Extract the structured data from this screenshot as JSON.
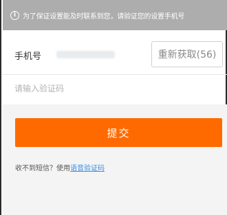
{
  "notice": {
    "icon": "info-circle-icon",
    "icon_glyph": "i",
    "text": "为了保证设置能及时联系到您，请验证您的设置手机号"
  },
  "phone": {
    "label": "手机号",
    "value_masked": "",
    "resend_label": "重新获取(56)"
  },
  "code": {
    "placeholder": "请输入验证码"
  },
  "submit": {
    "label": "提交"
  },
  "hint": {
    "prefix": "收不到短信？使用",
    "link": "语音验证码"
  },
  "colors": {
    "notice_bg": "#adadad",
    "accent": "#ff6a00",
    "link": "#3a8ee6"
  }
}
